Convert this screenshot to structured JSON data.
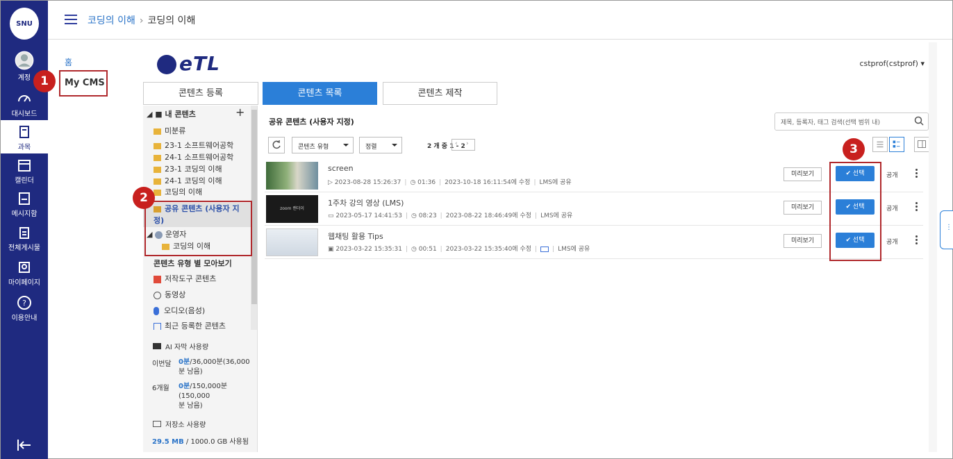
{
  "global_nav": {
    "logo_text": "SNU",
    "items": [
      {
        "label": "계정",
        "icon": "user-avatar-icon"
      },
      {
        "label": "대시보드",
        "icon": "dashboard-gauge-icon"
      },
      {
        "label": "과목",
        "icon": "book-icon"
      },
      {
        "label": "캘린더",
        "icon": "calendar-icon"
      },
      {
        "label": "메시지함",
        "icon": "inbox-icon"
      },
      {
        "label": "전체게시물",
        "icon": "clipboard-icon"
      },
      {
        "label": "마이페이지",
        "icon": "profile-card-icon"
      },
      {
        "label": "이용안내",
        "icon": "help-circle-icon"
      }
    ],
    "active_index": 2
  },
  "breadcrumb": {
    "course": "코딩의 이해",
    "current": "코딩의 이해"
  },
  "course_menu": {
    "home": "홈",
    "my_cms": "My CMS"
  },
  "badges": {
    "one": "1",
    "two": "2",
    "three": "3"
  },
  "etl": {
    "logo_text": "eTL",
    "user": "cstprof(cstprof)",
    "tabs": [
      {
        "label": "콘텐츠 등록"
      },
      {
        "label": "콘텐츠 목록"
      },
      {
        "label": "콘텐츠 제작"
      }
    ],
    "active_tab": 1
  },
  "tree": {
    "my_contents": "내 콘텐츠",
    "folders": [
      "미분류",
      "23-1 소프트웨어공학",
      "24-1 소프트웨어공학",
      "23-1 코딩의 이해",
      "24-1 코딩의 이해",
      "코딩의 이해"
    ],
    "shared_line1": "공유 콘텐츠 (사용자 지",
    "shared_line2": "정)",
    "admin": "운영자",
    "admin_child": "코딩의 이해",
    "by_type": "콘텐츠 유형 별 모아보기",
    "types": [
      "저작도구 콘텐츠",
      "동영상",
      "오디오(음성)",
      "최근 등록한 콘텐츠"
    ]
  },
  "usage": {
    "ai_title": "AI 자막 사용량",
    "month_label": "이번달",
    "month_used": "0분",
    "month_rest_a": "/36,000분(36,000",
    "month_rest_b": "분 남음)",
    "six_label": "6개월",
    "six_used": "0분",
    "six_rest_a": "/150,000분(150,000",
    "six_rest_b": "분 남음)",
    "storage_title": "저장소 사용량",
    "storage_used": "29.5 MB",
    "storage_total": " / 1000.0 GB 사용됨"
  },
  "main": {
    "title": "공유 콘텐츠 (사용자 지정)",
    "search_placeholder": "제목, 등록자, 태그 검색(선택 범위 내)",
    "type_filter": "콘텐츠 유형",
    "sort": "정렬",
    "count": "2 개 중 1 - 2",
    "rows": [
      {
        "name": "screen",
        "created": "2023-08-28 15:26:37",
        "duration": "01:36",
        "modified": "2023-10-18 16:11:54에 수정",
        "share": "LMS에 공유",
        "preview": "미리보기",
        "select": "선택",
        "public": "공개",
        "thumb_color": "#5a7f4d"
      },
      {
        "name": "1주차 강의 영상 (LMS)",
        "created": "2023-05-17 14:41:53",
        "duration": "08:23",
        "modified": "2023-08-22 18:46:49에 수정",
        "share": "LMS에 공유",
        "preview": "미리보기",
        "select": "선택",
        "public": "공개",
        "thumb_color": "#1a1a1a",
        "thumb_text": "zoom 랜더이"
      },
      {
        "name": "웹채팅 활용 Tips",
        "created": "2023-03-22 15:35:31",
        "duration": "00:51",
        "modified": "2023-03-22 15:35:40에 수정",
        "share": "LMS에 공유",
        "preview": "미리보기",
        "select": "선택",
        "public": "공개",
        "thumb_color": "#dfe6ee"
      }
    ]
  },
  "colors": {
    "nav": "#1f2a80",
    "accent": "#2b7fd8",
    "callout": "#b0282c",
    "badge": "#c8201e"
  }
}
